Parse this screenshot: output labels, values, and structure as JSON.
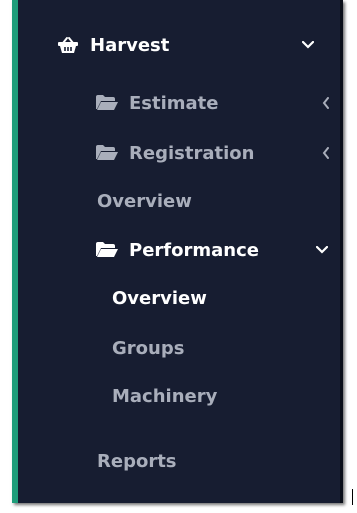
{
  "sidebar": {
    "accent_color": "#1f9d7a",
    "background_color": "#171d31",
    "harvest": {
      "label": "Harvest",
      "icon": "basket-icon",
      "caret": "chevron-down-icon"
    },
    "estimate": {
      "label": "Estimate",
      "icon": "folder-open-icon",
      "caret": "chevron-left-icon"
    },
    "registration": {
      "label": "Registration",
      "icon": "folder-open-icon",
      "caret": "chevron-left-icon"
    },
    "overview_top": {
      "label": "Overview"
    },
    "performance": {
      "label": "Performance",
      "icon": "folder-open-icon",
      "caret": "chevron-down-icon",
      "children": {
        "overview": {
          "label": "Overview",
          "active": true
        },
        "groups": {
          "label": "Groups"
        },
        "machinery": {
          "label": "Machinery"
        }
      }
    },
    "reports": {
      "label": "Reports"
    }
  }
}
